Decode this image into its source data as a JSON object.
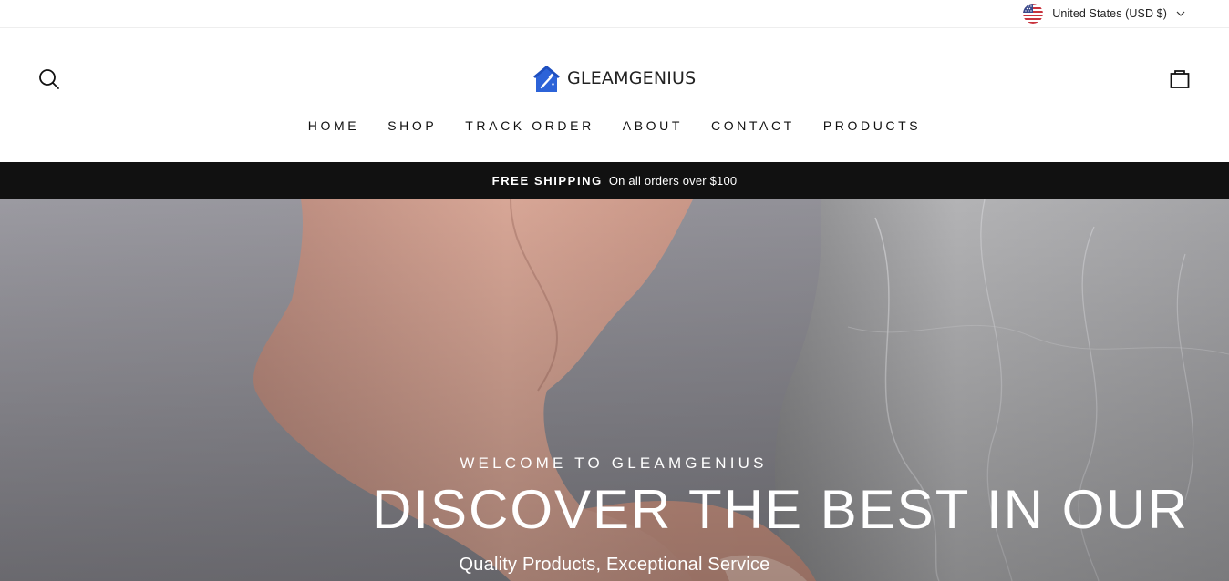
{
  "topbar": {
    "currency_label": "United States (USD $)",
    "flag_icon": "us-flag-icon",
    "chevron_icon": "chevron-down-icon"
  },
  "header": {
    "logo_text": "GLEAMGENIUS",
    "logo_icon": "house-logo-icon",
    "logo_color": "#2c63d8",
    "search_icon": "search-icon",
    "cart_icon": "cart-bag-icon"
  },
  "nav": {
    "items": [
      {
        "label": "HOME"
      },
      {
        "label": "SHOP"
      },
      {
        "label": "TRACK ORDER"
      },
      {
        "label": "ABOUT"
      },
      {
        "label": "CONTACT"
      },
      {
        "label": "PRODUCTS"
      }
    ]
  },
  "announcement": {
    "strong": "FREE SHIPPING",
    "text": "On all orders over $100",
    "background": "#111111"
  },
  "hero": {
    "kicker": "WELCOME TO GLEAMGENIUS",
    "title": "DISCOVER THE BEST IN OUR",
    "subtitle": "Quality Products, Exceptional Service"
  }
}
